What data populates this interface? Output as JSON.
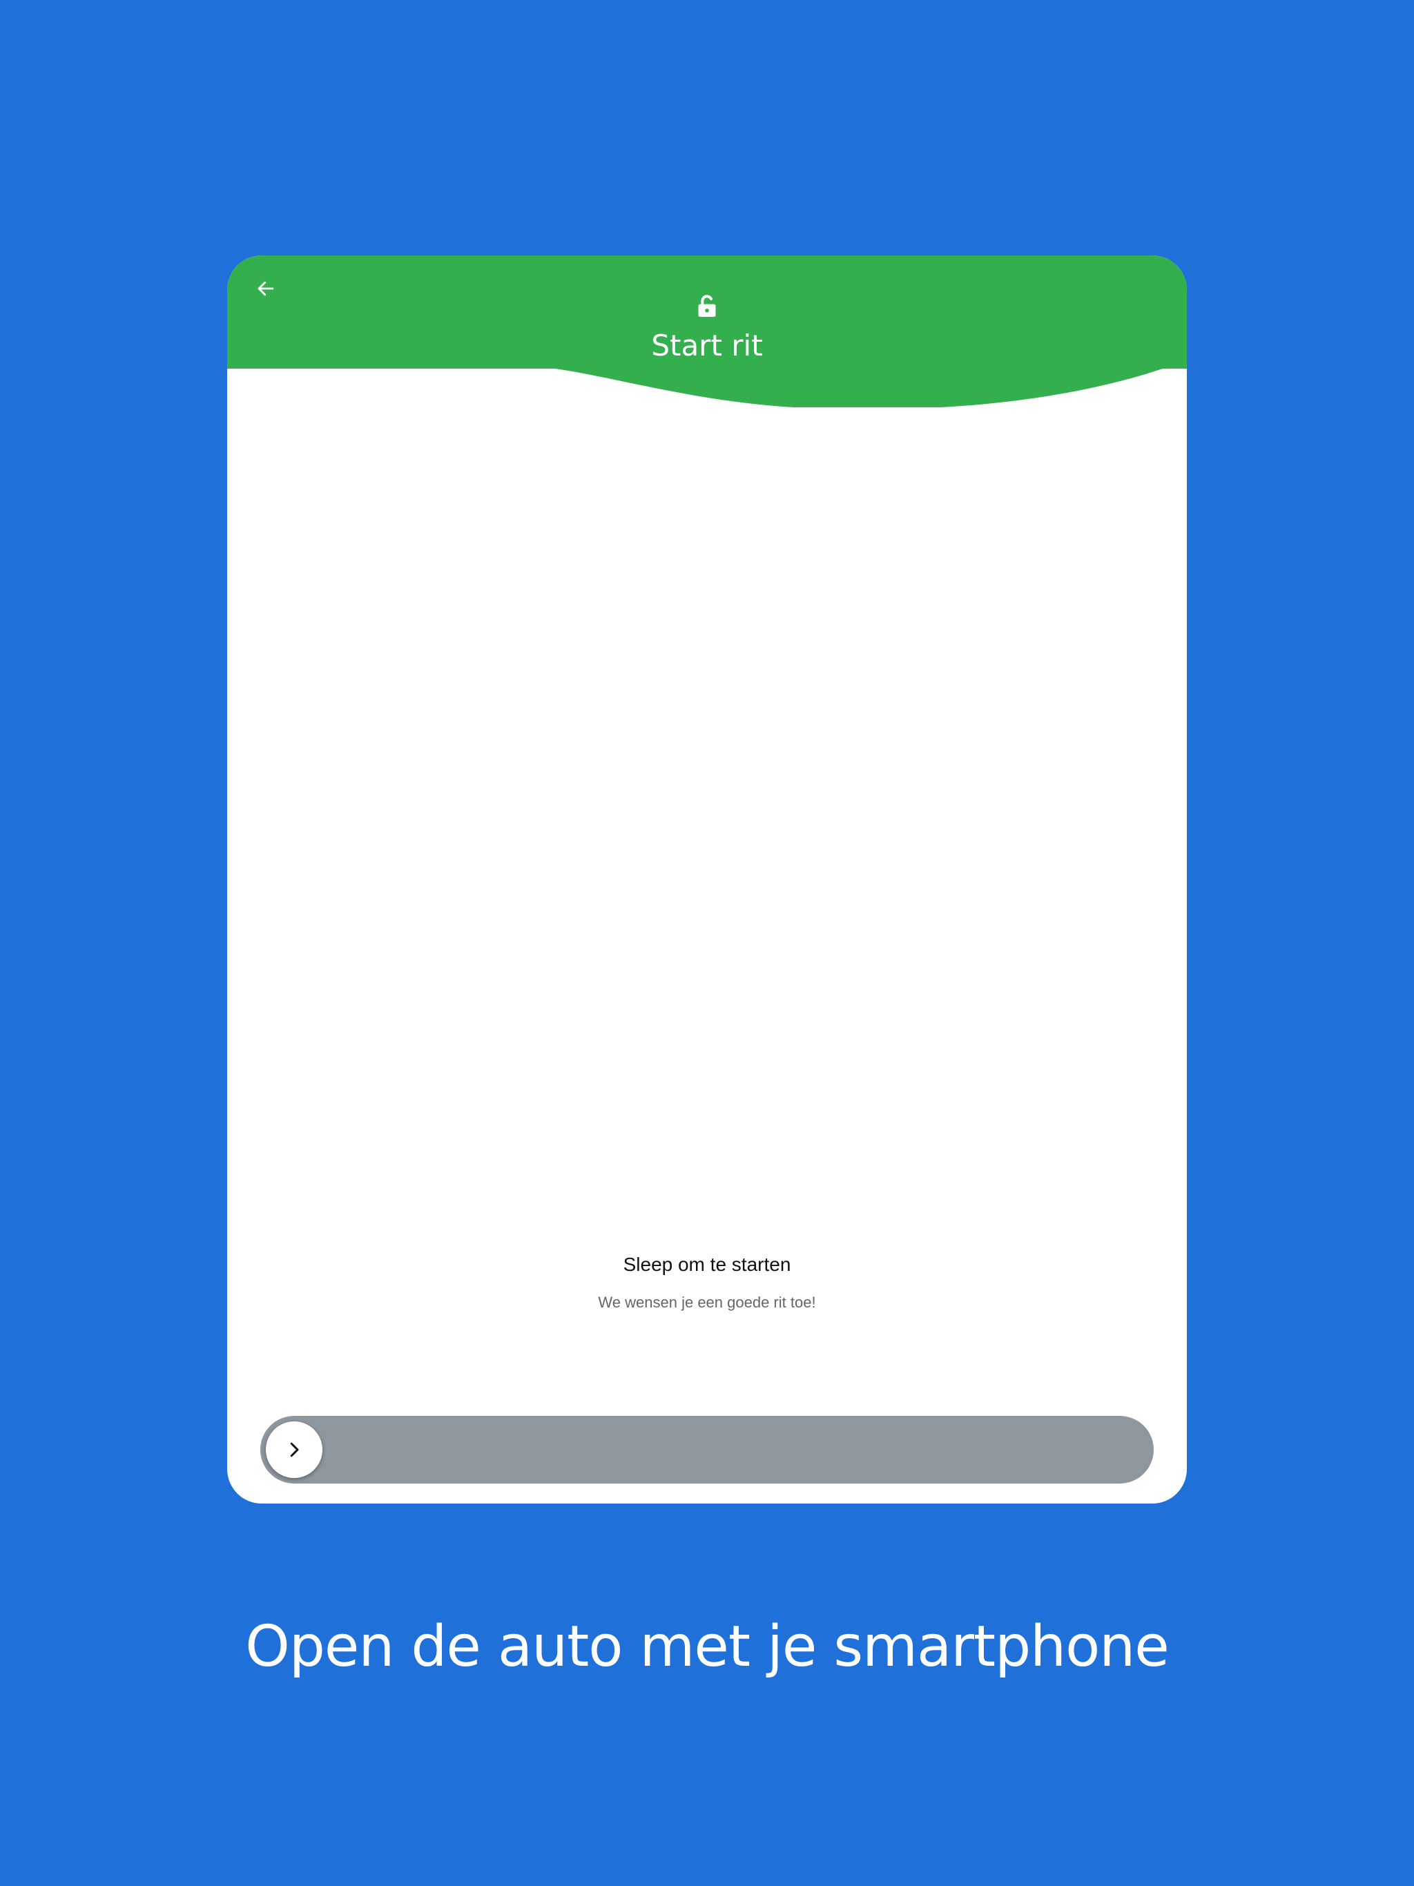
{
  "header": {
    "title": "Start rit",
    "back_icon": "arrow-left-icon",
    "lock_icon": "lock-open-icon",
    "color": "#33b04d"
  },
  "main": {
    "title": "Sleep om te starten",
    "subtitle": "We wensen je een goede rit toe!"
  },
  "slider": {
    "handle_icon": "chevron-right-icon",
    "track_color": "#8e969e",
    "progress": 0
  },
  "tagline": "Open de auto met je smartphone",
  "colors": {
    "background": "#1f70d9",
    "card": "#ffffff"
  }
}
